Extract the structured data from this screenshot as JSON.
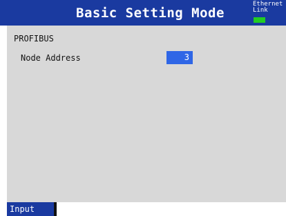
{
  "header": {
    "title": "Basic Setting Mode",
    "ethernet_label": "Ethernet",
    "link_label": "Link",
    "link_status_color": "#22cc22"
  },
  "main": {
    "section_title": "PROFIBUS",
    "node_address": {
      "label": "Node Address",
      "value": "3"
    }
  },
  "softkeys": {
    "input_label": "Input"
  },
  "colors": {
    "title_bar": "#1a3aa0",
    "panel_background": "#d8d8d8",
    "selected_field": "#2f66e6"
  }
}
